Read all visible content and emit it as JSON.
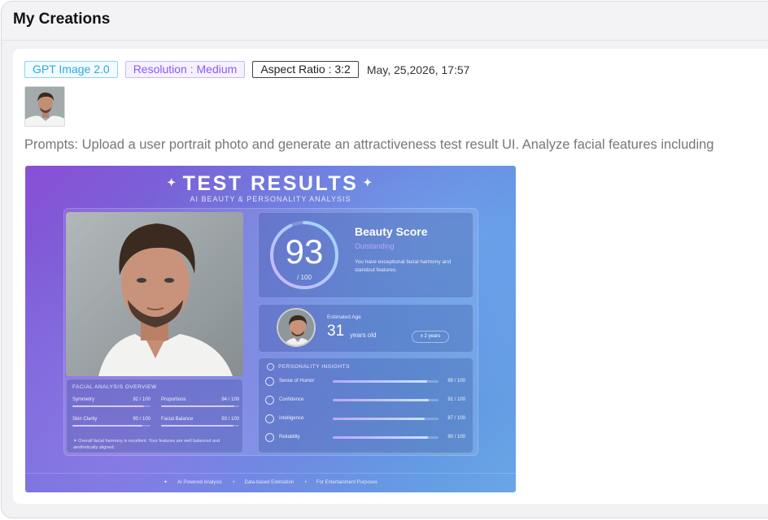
{
  "page": {
    "title": "My Creations"
  },
  "creation": {
    "model_tag": "GPT Image 2.0",
    "resolution_tag": "Resolution : Medium",
    "aspect_tag": "Aspect Ratio : 3:2",
    "date": "May, 25,2026, 17:57",
    "prompt": "Prompts: Upload a user portrait photo and generate an attractiveness test result UI. Analyze facial features including"
  },
  "result": {
    "title": "TEST RESULTS",
    "subtitle": "AI BEAUTY & PERSONALITY ANALYSIS",
    "facial": {
      "heading": "FACIAL ANALYSIS OVERVIEW",
      "items": [
        {
          "label": "Symmetry",
          "value": "92 / 100",
          "score": 92
        },
        {
          "label": "Proportions",
          "value": "94 / 100",
          "score": 94
        },
        {
          "label": "Skin Clarity",
          "value": "90 / 100",
          "score": 90
        },
        {
          "label": "Facial Balance",
          "value": "93 / 100",
          "score": 93
        }
      ],
      "note": "Overall facial harmony is excellent. Your features are well balanced and aesthetically aligned."
    },
    "score": {
      "value": "93",
      "denominator": "/ 100",
      "fraction": 0.93,
      "title": "Beauty Score",
      "rating": "Outstanding",
      "description": "You have exceptional facial harmony and standout features."
    },
    "age": {
      "label": "Estimated Age",
      "value": "31",
      "unit": "years old",
      "range": "± 2 years"
    },
    "personality": {
      "heading": "PERSONALITY INSIGHTS",
      "items": [
        {
          "label": "Sense of Humor",
          "value": "89 / 100",
          "score": 89,
          "icon": "smile-icon"
        },
        {
          "label": "Confidence",
          "value": "91 / 100",
          "score": 91,
          "icon": "star-icon"
        },
        {
          "label": "Intelligence",
          "value": "87 / 100",
          "score": 87,
          "icon": "brain-icon"
        },
        {
          "label": "Reliability",
          "value": "90 / 100",
          "score": 90,
          "icon": "shield-icon"
        }
      ]
    },
    "footer": [
      "AI Powered Analysis",
      "Data-based Estimation",
      "For Entertainment Purposes"
    ]
  },
  "colors": {
    "model_tag": "#2eaadc",
    "resolution_tag": "#8b5cf6",
    "accent": "#b9a8ff"
  }
}
